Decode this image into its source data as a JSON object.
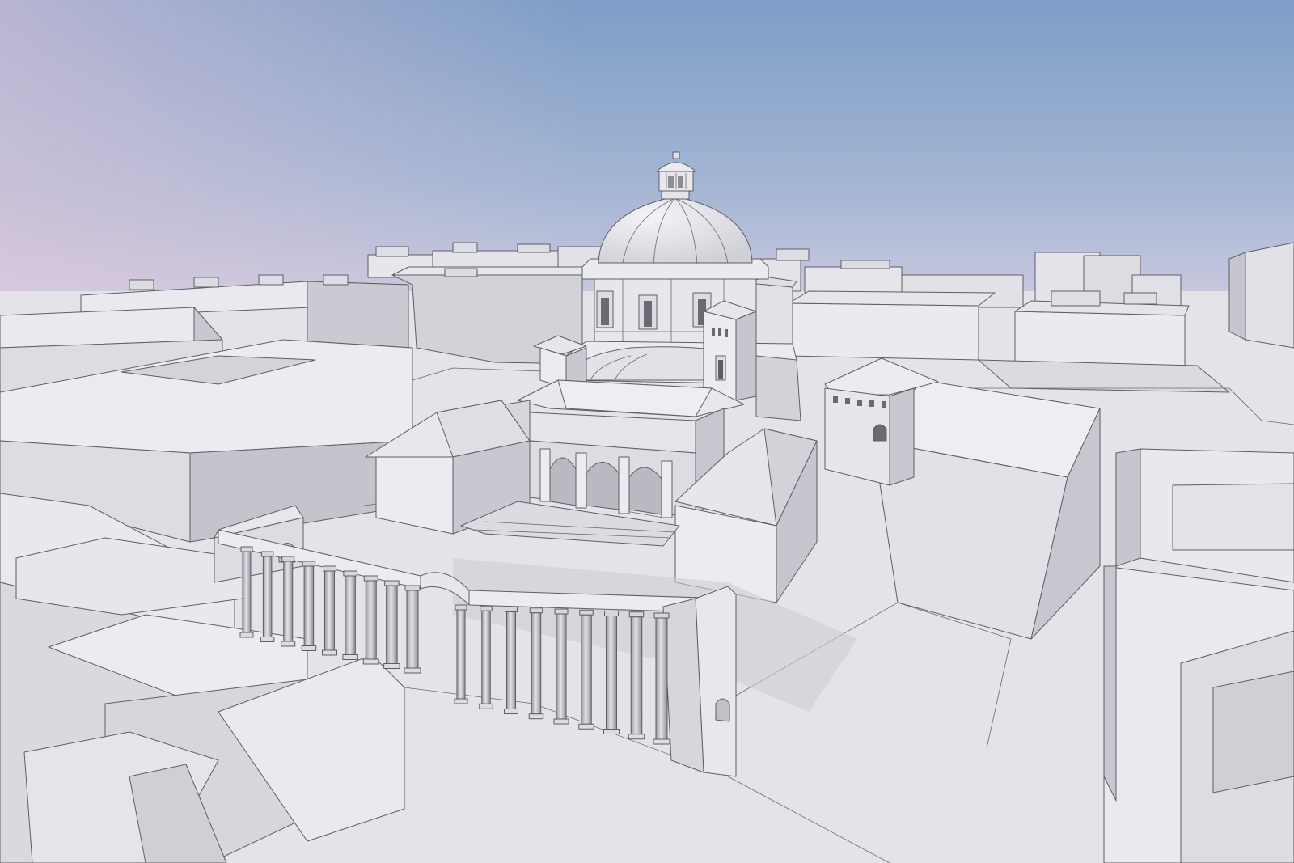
{
  "colors": {
    "sky_top": "#7d9dc6",
    "sky_mid": "#a4b6d3",
    "sky_horizon": "#d6cfe2",
    "ground": "#e4e3e8",
    "wall_lit": "#ececf0",
    "wall_mid": "#d8d8de",
    "wall_shade": "#bdbdc5",
    "roof": "#e7e7eb",
    "shadow": "#cdcdd4",
    "edge": "#5e5e66"
  }
}
